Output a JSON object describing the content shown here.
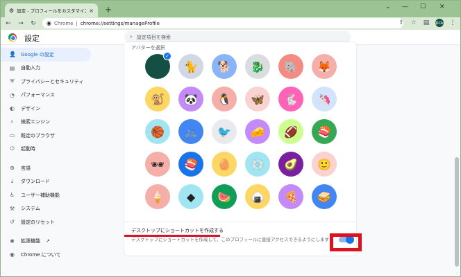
{
  "browser": {
    "tab_title": "設定 - プロフィールをカスタマイズ",
    "url_scheme": "Chrome",
    "url_path": "chrome://settings/manageProfile",
    "profile_initials": "鈴Ok"
  },
  "settings": {
    "title": "設定",
    "search_placeholder": "設定項目を検索"
  },
  "sidebar": {
    "items": [
      {
        "label": "Google の設定",
        "icon": "person-icon"
      },
      {
        "label": "自動入力",
        "icon": "clipboard-icon"
      },
      {
        "label": "プライバシーとセキュリティ",
        "icon": "shield-icon"
      },
      {
        "label": "パフォーマンス",
        "icon": "speedometer-icon"
      },
      {
        "label": "デザイン",
        "icon": "palette-icon"
      },
      {
        "label": "検索エンジン",
        "icon": "search-icon"
      },
      {
        "label": "既定のブラウザ",
        "icon": "browser-icon"
      },
      {
        "label": "起動時",
        "icon": "power-icon"
      },
      {
        "label": "言語",
        "icon": "globe-icon"
      },
      {
        "label": "ダウンロード",
        "icon": "download-icon"
      },
      {
        "label": "ユーザー補助機能",
        "icon": "accessibility-icon"
      },
      {
        "label": "システム",
        "icon": "wrench-icon"
      },
      {
        "label": "設定のリセット",
        "icon": "reset-icon"
      },
      {
        "label": "拡張機能",
        "icon": "puzzle-icon"
      },
      {
        "label": "Chrome について",
        "icon": "chrome-icon"
      }
    ]
  },
  "avatar_section": {
    "label": "アバターを選択",
    "selected_index": 0,
    "avatars": [
      {
        "name": "dark-green-avatar",
        "glyph": "",
        "color": "#134f42"
      },
      {
        "name": "cat-avatar",
        "glyph": "🐈",
        "color": "#cfd8e3"
      },
      {
        "name": "corgi-avatar",
        "glyph": "🐕",
        "color": "#8ab4f8"
      },
      {
        "name": "dragon-avatar",
        "glyph": "🐉",
        "color": "#dadce0"
      },
      {
        "name": "elephant-avatar",
        "glyph": "🐘",
        "color": "#f28b82"
      },
      {
        "name": "fox-avatar",
        "glyph": "🦊",
        "color": "#f6aea9"
      },
      {
        "name": "monkey-avatar",
        "glyph": "🐒",
        "color": "#fdd663"
      },
      {
        "name": "panda-avatar",
        "glyph": "🐼",
        "color": "#c58af9"
      },
      {
        "name": "penguin-avatar",
        "glyph": "🐧",
        "color": "#f6aea9"
      },
      {
        "name": "butterfly-avatar",
        "glyph": "🦋",
        "color": "#fad2cf"
      },
      {
        "name": "rabbit-avatar",
        "glyph": "🐇",
        "color": "#ff63b8"
      },
      {
        "name": "unicorn-avatar",
        "glyph": "🦄",
        "color": "#d2e3fc"
      },
      {
        "name": "basketball-avatar",
        "glyph": "🏀",
        "color": "#a1e4f2"
      },
      {
        "name": "bicycle-avatar",
        "glyph": "🚲",
        "color": "#4285f4"
      },
      {
        "name": "bird-avatar",
        "glyph": "🐦",
        "color": "#e8eaed"
      },
      {
        "name": "cheese-avatar",
        "glyph": "🧀",
        "color": "#c58af9"
      },
      {
        "name": "football-avatar",
        "glyph": "🏈",
        "color": "#ccff90"
      },
      {
        "name": "sushi-plate-avatar",
        "glyph": "🍣",
        "color": "#34a853"
      },
      {
        "name": "sunglasses-avatar",
        "glyph": "🕶",
        "color": "#f6aea9"
      },
      {
        "name": "sushi-avatar",
        "glyph": "🍣",
        "color": "#1a73e8"
      },
      {
        "name": "tamagotchi-avatar",
        "glyph": "🥚",
        "color": "#fdd663"
      },
      {
        "name": "vinyl-avatar",
        "glyph": "💿",
        "color": "#a1e4f2"
      },
      {
        "name": "avocado-avatar",
        "glyph": "🥑",
        "color": "#7b1fa2"
      },
      {
        "name": "smiley-avatar",
        "glyph": "🙂",
        "color": "#fad2cf"
      },
      {
        "name": "ice-cream-avatar",
        "glyph": "🍦",
        "color": "#f6aea9"
      },
      {
        "name": "origami-avatar",
        "glyph": "◆",
        "color": "#a1e4f2"
      },
      {
        "name": "watermelon-avatar",
        "glyph": "🍉",
        "color": "#0f9d58"
      },
      {
        "name": "onigiri-avatar",
        "glyph": "🍙",
        "color": "#fdd663"
      },
      {
        "name": "pizza-avatar",
        "glyph": "🍕",
        "color": "#c58af9"
      },
      {
        "name": "sandwich-avatar",
        "glyph": "🥪",
        "color": "#4285f4"
      }
    ]
  },
  "shortcut": {
    "title": "デスクトップにショートカットを作成する",
    "description": "デスクトップにショートカットを作成して、このプロフィールに直接アクセスできるようにします",
    "enabled": true
  }
}
